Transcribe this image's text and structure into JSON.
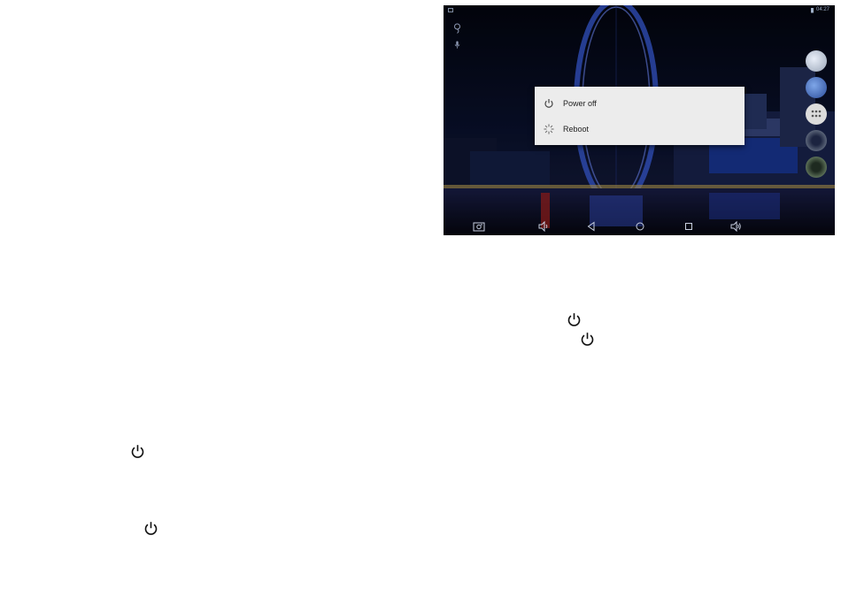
{
  "status_bar": {
    "time": "04:27"
  },
  "dialog": {
    "items": [
      {
        "label": "Power off",
        "icon": "power-icon"
      },
      {
        "label": "Reboot",
        "icon": "spinner-icon"
      }
    ]
  },
  "navbar": {
    "buttons": [
      "screenshot-icon",
      "volume-down-icon",
      "back-icon",
      "home-icon",
      "recents-icon",
      "volume-up-icon"
    ]
  },
  "page_icons": [
    "power-icon",
    "power-icon",
    "power-icon",
    "power-icon"
  ],
  "colors": {
    "dialog_bg": "#ececec",
    "screen_bg": "#040716",
    "icon": "#111111"
  }
}
